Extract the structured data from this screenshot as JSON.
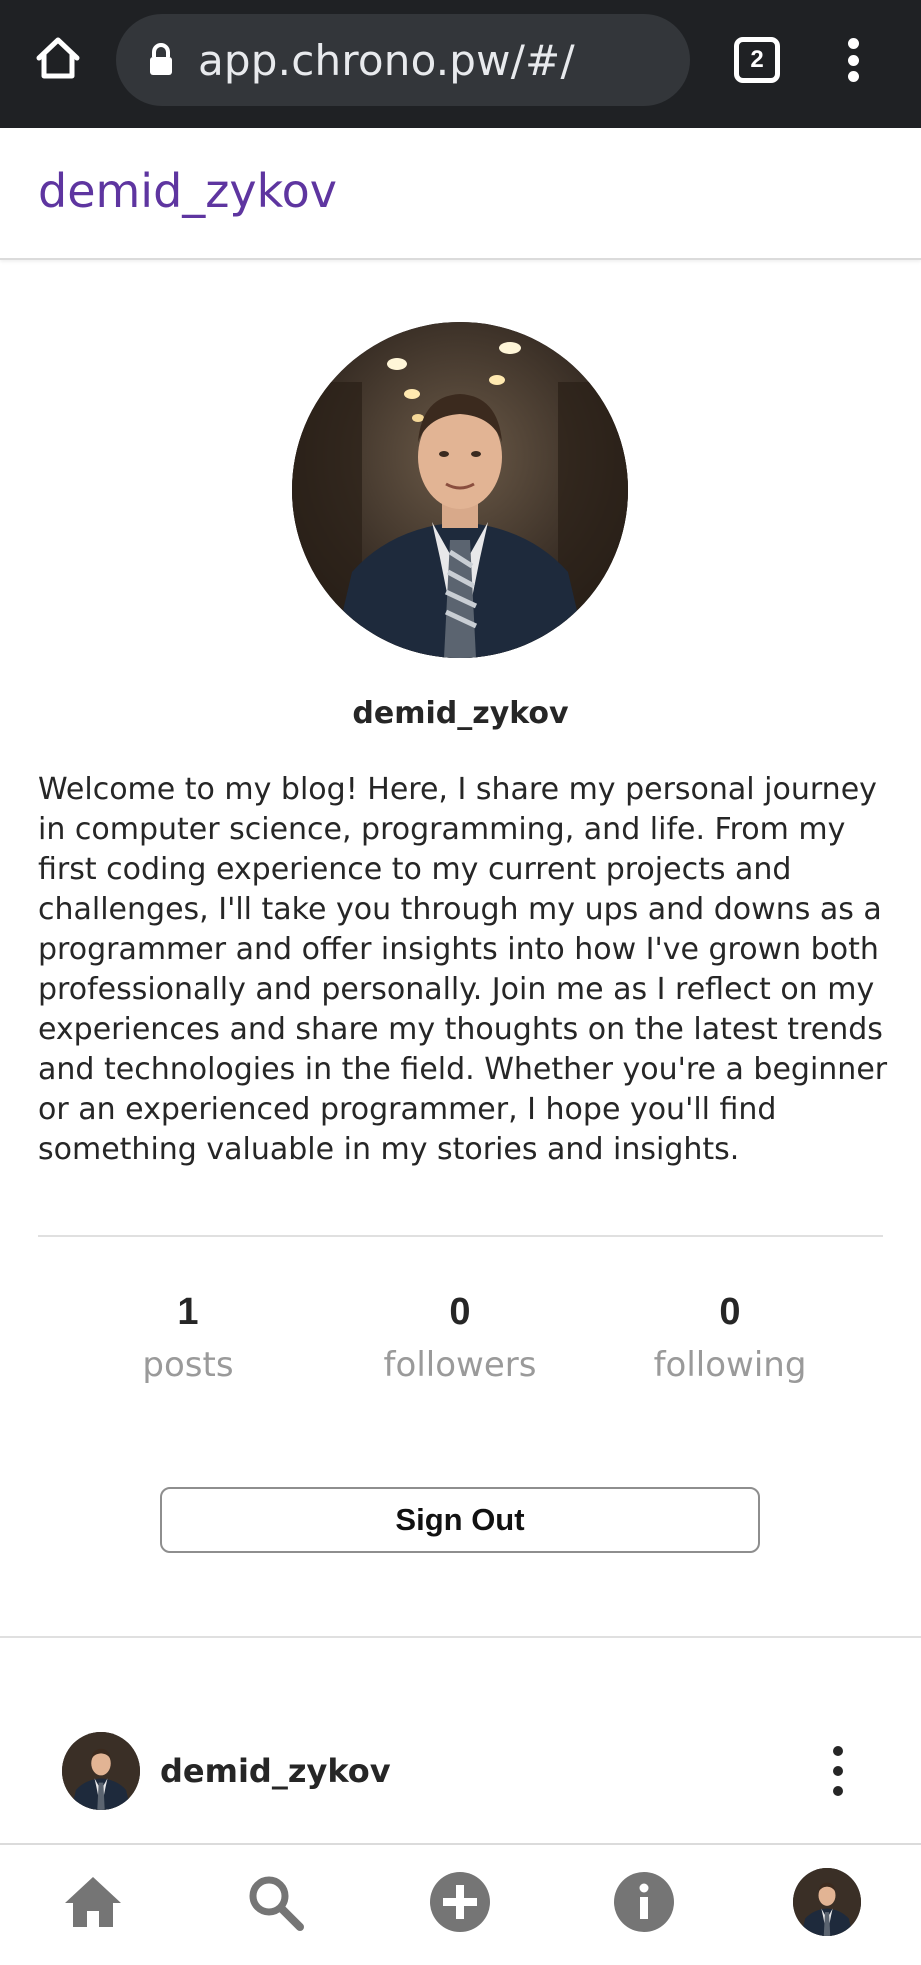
{
  "browser": {
    "url": "app.chrono.pw/#/",
    "tab_count": "2"
  },
  "header": {
    "title": "demid_zykov"
  },
  "profile": {
    "username": "demid_zykov",
    "bio": "Welcome to my blog! Here, I share my personal journey in computer science, programming, and life. From my first coding experience to my current projects and challenges, I'll take you through my ups and downs as a programmer and offer insights into how I've grown both professionally and personally. Join me as I reflect on my experiences and share my thoughts on the latest trends and technologies in the field. Whether you're a beginner or an experienced programmer, I hope you'll find something valuable in my stories and insights.",
    "stats": [
      {
        "value": "1",
        "label": "posts"
      },
      {
        "value": "0",
        "label": "followers"
      },
      {
        "value": "0",
        "label": "following"
      }
    ],
    "sign_out_label": "Sign Out"
  },
  "post": {
    "author": "demid_zykov"
  },
  "nav": {
    "items": [
      "home-icon",
      "search-icon",
      "add-post-icon",
      "info-icon",
      "profile-avatar"
    ]
  },
  "colors": {
    "accent": "#5e35a0",
    "browser_bar": "#1f2124",
    "nav_icon": "#757575"
  }
}
